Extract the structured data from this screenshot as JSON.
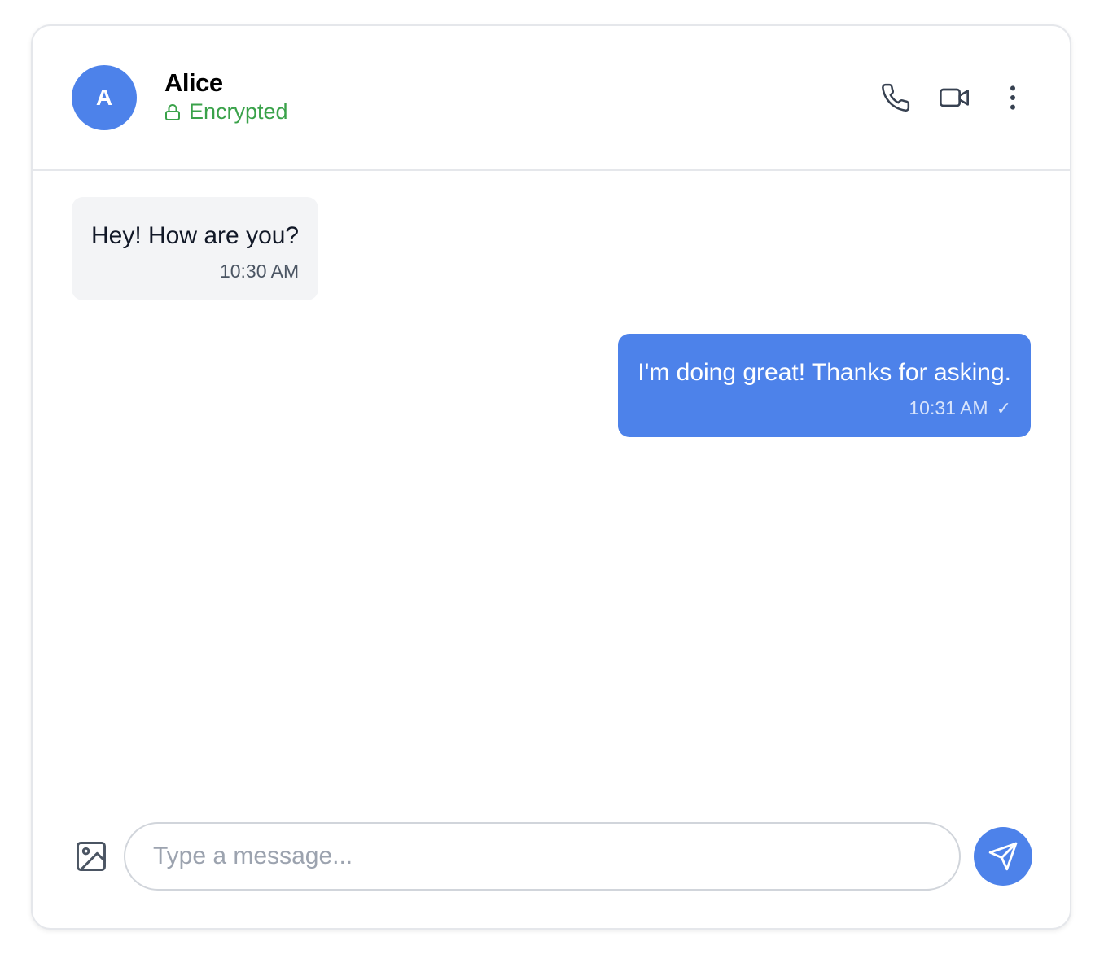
{
  "header": {
    "avatar_initial": "A",
    "contact_name": "Alice",
    "status_text": "Encrypted",
    "status_icon": "lock-icon",
    "actions": [
      {
        "name": "phone-icon"
      },
      {
        "name": "video-icon"
      },
      {
        "name": "more-vertical-icon"
      }
    ]
  },
  "messages": [
    {
      "direction": "incoming",
      "text": "Hey! How are you?",
      "time": "10:30 AM"
    },
    {
      "direction": "outgoing",
      "text": "I'm doing great! Thanks for asking.",
      "time": "10:31 AM",
      "status_glyph": "✓"
    }
  ],
  "composer": {
    "placeholder": "Type a message...",
    "value": "",
    "attach_icon": "image-icon",
    "send_icon": "send-icon"
  },
  "colors": {
    "accent": "#4d82ea",
    "encrypted_green": "#3aa24a",
    "incoming_bubble": "#f3f4f6",
    "border": "#e5e7eb"
  }
}
